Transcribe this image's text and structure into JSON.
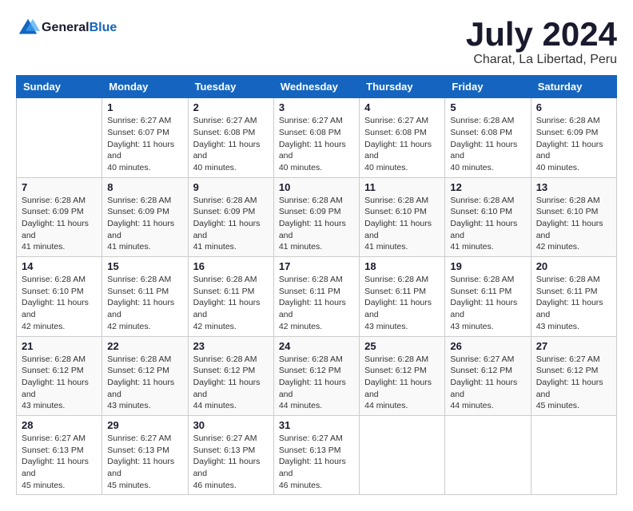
{
  "header": {
    "logo": {
      "general": "General",
      "blue": "Blue"
    },
    "title": "July 2024",
    "location": "Charat, La Libertad, Peru"
  },
  "calendar": {
    "weekdays": [
      "Sunday",
      "Monday",
      "Tuesday",
      "Wednesday",
      "Thursday",
      "Friday",
      "Saturday"
    ],
    "weeks": [
      [
        {
          "day": "",
          "sunrise": "",
          "sunset": "",
          "daylight": ""
        },
        {
          "day": "1",
          "sunrise": "Sunrise: 6:27 AM",
          "sunset": "Sunset: 6:07 PM",
          "daylight": "Daylight: 11 hours and 40 minutes."
        },
        {
          "day": "2",
          "sunrise": "Sunrise: 6:27 AM",
          "sunset": "Sunset: 6:08 PM",
          "daylight": "Daylight: 11 hours and 40 minutes."
        },
        {
          "day": "3",
          "sunrise": "Sunrise: 6:27 AM",
          "sunset": "Sunset: 6:08 PM",
          "daylight": "Daylight: 11 hours and 40 minutes."
        },
        {
          "day": "4",
          "sunrise": "Sunrise: 6:27 AM",
          "sunset": "Sunset: 6:08 PM",
          "daylight": "Daylight: 11 hours and 40 minutes."
        },
        {
          "day": "5",
          "sunrise": "Sunrise: 6:28 AM",
          "sunset": "Sunset: 6:08 PM",
          "daylight": "Daylight: 11 hours and 40 minutes."
        },
        {
          "day": "6",
          "sunrise": "Sunrise: 6:28 AM",
          "sunset": "Sunset: 6:09 PM",
          "daylight": "Daylight: 11 hours and 40 minutes."
        }
      ],
      [
        {
          "day": "7",
          "sunrise": "Sunrise: 6:28 AM",
          "sunset": "Sunset: 6:09 PM",
          "daylight": "Daylight: 11 hours and 41 minutes."
        },
        {
          "day": "8",
          "sunrise": "Sunrise: 6:28 AM",
          "sunset": "Sunset: 6:09 PM",
          "daylight": "Daylight: 11 hours and 41 minutes."
        },
        {
          "day": "9",
          "sunrise": "Sunrise: 6:28 AM",
          "sunset": "Sunset: 6:09 PM",
          "daylight": "Daylight: 11 hours and 41 minutes."
        },
        {
          "day": "10",
          "sunrise": "Sunrise: 6:28 AM",
          "sunset": "Sunset: 6:09 PM",
          "daylight": "Daylight: 11 hours and 41 minutes."
        },
        {
          "day": "11",
          "sunrise": "Sunrise: 6:28 AM",
          "sunset": "Sunset: 6:10 PM",
          "daylight": "Daylight: 11 hours and 41 minutes."
        },
        {
          "day": "12",
          "sunrise": "Sunrise: 6:28 AM",
          "sunset": "Sunset: 6:10 PM",
          "daylight": "Daylight: 11 hours and 41 minutes."
        },
        {
          "day": "13",
          "sunrise": "Sunrise: 6:28 AM",
          "sunset": "Sunset: 6:10 PM",
          "daylight": "Daylight: 11 hours and 42 minutes."
        }
      ],
      [
        {
          "day": "14",
          "sunrise": "Sunrise: 6:28 AM",
          "sunset": "Sunset: 6:10 PM",
          "daylight": "Daylight: 11 hours and 42 minutes."
        },
        {
          "day": "15",
          "sunrise": "Sunrise: 6:28 AM",
          "sunset": "Sunset: 6:11 PM",
          "daylight": "Daylight: 11 hours and 42 minutes."
        },
        {
          "day": "16",
          "sunrise": "Sunrise: 6:28 AM",
          "sunset": "Sunset: 6:11 PM",
          "daylight": "Daylight: 11 hours and 42 minutes."
        },
        {
          "day": "17",
          "sunrise": "Sunrise: 6:28 AM",
          "sunset": "Sunset: 6:11 PM",
          "daylight": "Daylight: 11 hours and 42 minutes."
        },
        {
          "day": "18",
          "sunrise": "Sunrise: 6:28 AM",
          "sunset": "Sunset: 6:11 PM",
          "daylight": "Daylight: 11 hours and 43 minutes."
        },
        {
          "day": "19",
          "sunrise": "Sunrise: 6:28 AM",
          "sunset": "Sunset: 6:11 PM",
          "daylight": "Daylight: 11 hours and 43 minutes."
        },
        {
          "day": "20",
          "sunrise": "Sunrise: 6:28 AM",
          "sunset": "Sunset: 6:11 PM",
          "daylight": "Daylight: 11 hours and 43 minutes."
        }
      ],
      [
        {
          "day": "21",
          "sunrise": "Sunrise: 6:28 AM",
          "sunset": "Sunset: 6:12 PM",
          "daylight": "Daylight: 11 hours and 43 minutes."
        },
        {
          "day": "22",
          "sunrise": "Sunrise: 6:28 AM",
          "sunset": "Sunset: 6:12 PM",
          "daylight": "Daylight: 11 hours and 43 minutes."
        },
        {
          "day": "23",
          "sunrise": "Sunrise: 6:28 AM",
          "sunset": "Sunset: 6:12 PM",
          "daylight": "Daylight: 11 hours and 44 minutes."
        },
        {
          "day": "24",
          "sunrise": "Sunrise: 6:28 AM",
          "sunset": "Sunset: 6:12 PM",
          "daylight": "Daylight: 11 hours and 44 minutes."
        },
        {
          "day": "25",
          "sunrise": "Sunrise: 6:28 AM",
          "sunset": "Sunset: 6:12 PM",
          "daylight": "Daylight: 11 hours and 44 minutes."
        },
        {
          "day": "26",
          "sunrise": "Sunrise: 6:27 AM",
          "sunset": "Sunset: 6:12 PM",
          "daylight": "Daylight: 11 hours and 44 minutes."
        },
        {
          "day": "27",
          "sunrise": "Sunrise: 6:27 AM",
          "sunset": "Sunset: 6:12 PM",
          "daylight": "Daylight: 11 hours and 45 minutes."
        }
      ],
      [
        {
          "day": "28",
          "sunrise": "Sunrise: 6:27 AM",
          "sunset": "Sunset: 6:13 PM",
          "daylight": "Daylight: 11 hours and 45 minutes."
        },
        {
          "day": "29",
          "sunrise": "Sunrise: 6:27 AM",
          "sunset": "Sunset: 6:13 PM",
          "daylight": "Daylight: 11 hours and 45 minutes."
        },
        {
          "day": "30",
          "sunrise": "Sunrise: 6:27 AM",
          "sunset": "Sunset: 6:13 PM",
          "daylight": "Daylight: 11 hours and 46 minutes."
        },
        {
          "day": "31",
          "sunrise": "Sunrise: 6:27 AM",
          "sunset": "Sunset: 6:13 PM",
          "daylight": "Daylight: 11 hours and 46 minutes."
        },
        {
          "day": "",
          "sunrise": "",
          "sunset": "",
          "daylight": ""
        },
        {
          "day": "",
          "sunrise": "",
          "sunset": "",
          "daylight": ""
        },
        {
          "day": "",
          "sunrise": "",
          "sunset": "",
          "daylight": ""
        }
      ]
    ]
  }
}
